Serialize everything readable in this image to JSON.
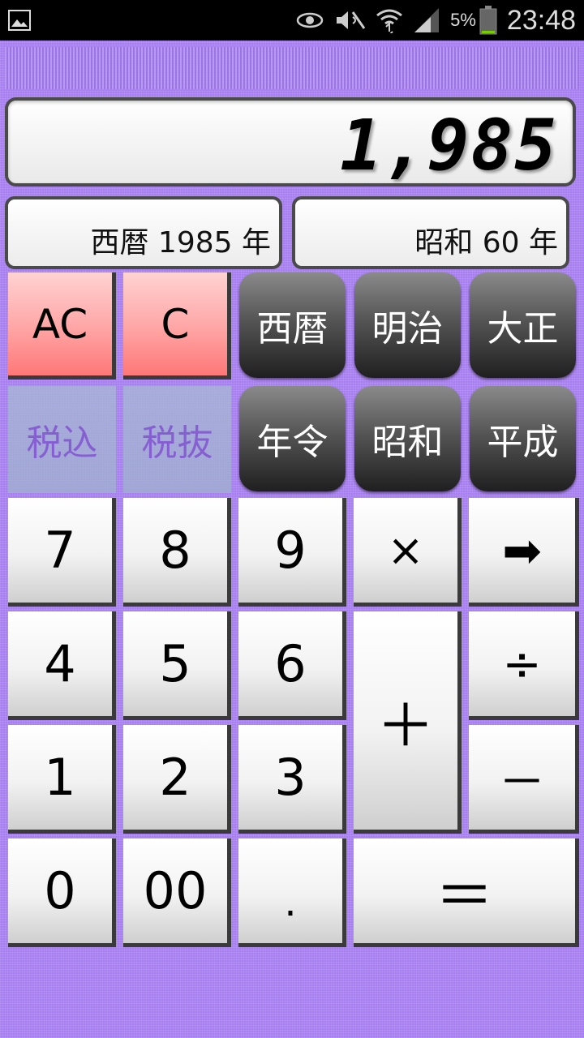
{
  "status_bar": {
    "battery_text": "5%",
    "time": "23:48",
    "icons": [
      "gallery-icon",
      "eye-icon",
      "mute-icon",
      "wifi-icon",
      "signal-icon",
      "battery-icon"
    ]
  },
  "display": {
    "value": "1,985"
  },
  "sub_display": {
    "western": "西暦 1985 年",
    "japanese": "昭和 60 年"
  },
  "buttons": {
    "ac": "AC",
    "c": "C",
    "seireki": "西暦",
    "meiji": "明治",
    "taisho": "大正",
    "zeikomi": "税込",
    "zeinuki": "税抜",
    "nenrei": "年令",
    "showa": "昭和",
    "heisei": "平成",
    "n7": "7",
    "n8": "8",
    "n9": "9",
    "multiply": "×",
    "arrow": "➡",
    "n4": "4",
    "n5": "5",
    "n6": "6",
    "plus": "＋",
    "divide": "÷",
    "n1": "1",
    "n2": "2",
    "n3": "3",
    "minus": "－",
    "n0": "0",
    "n00": "00",
    "dot": ".",
    "equals": "＝"
  },
  "colors": {
    "background": "#a77ff0",
    "clear_button": "#ff8a8a",
    "era_button": "#333333",
    "tax_button": "#a7b9d3"
  }
}
